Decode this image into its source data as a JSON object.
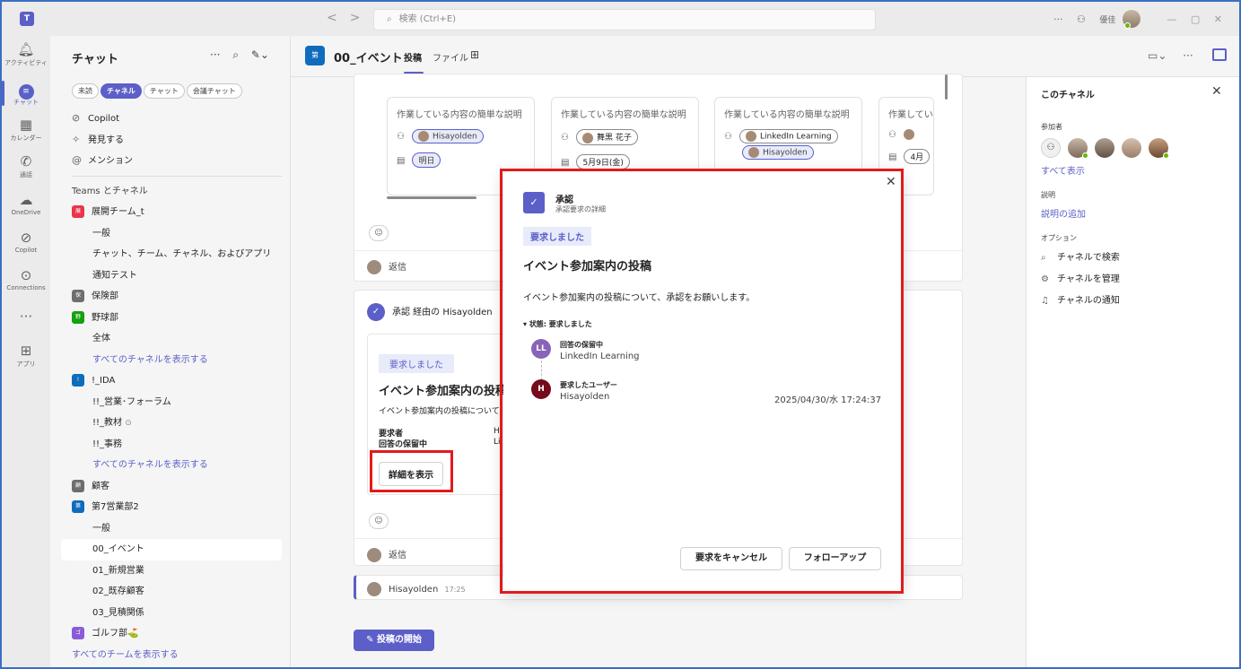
{
  "titlebar": {
    "search_placeholder": "検索 (Ctrl+E)",
    "user_name": "優佳",
    "more": "···"
  },
  "rail": [
    {
      "label": "アクティビティ",
      "icon": "bell-icon"
    },
    {
      "label": "チャット",
      "icon": "chat-icon"
    },
    {
      "label": "カレンダー",
      "icon": "calendar-icon"
    },
    {
      "label": "通話",
      "icon": "phone-icon"
    },
    {
      "label": "OneDrive",
      "icon": "cloud-icon"
    },
    {
      "label": "Copilot",
      "icon": "copilot-icon"
    },
    {
      "label": "Connections",
      "icon": "connections-icon"
    },
    {
      "label": "アプリ",
      "icon": "apps-icon"
    }
  ],
  "sidebar": {
    "title": "チャット",
    "filters": [
      "未読",
      "チャネル",
      "チャット",
      "会議チャット"
    ],
    "top_items": [
      {
        "icon": "copilot-icon",
        "label": "Copilot"
      },
      {
        "icon": "sparkle-icon",
        "label": "発見する"
      },
      {
        "icon": "at-icon",
        "label": "メンション"
      }
    ],
    "section_label": "Teams とチャネル",
    "teams": [
      {
        "name": "展開チーム_t",
        "color": "#e8364b",
        "channels": [
          "一般",
          "チャット、チーム、チャネル、およびアプリ",
          "通知テスト"
        ],
        "show_all": ""
      },
      {
        "name": "保険部",
        "color": "#6e6e6e",
        "channels": [],
        "show_all": ""
      },
      {
        "name": "野球部",
        "color": "#13a10e",
        "channels": [
          "全体"
        ],
        "show_all": "すべてのチャネルを表示する"
      },
      {
        "name": "!_IDA",
        "color": "#0f6cbd",
        "channels": [
          "!!_営業･フォーラム",
          "!!_教材",
          "!!_事務"
        ],
        "show_all": "すべてのチャネルを表示する"
      },
      {
        "name": "顧客",
        "color": "#6e6e6e",
        "channels": [],
        "show_all": ""
      },
      {
        "name": "第7営業部2",
        "color": "#0f6cbd",
        "channels": [
          "一般",
          "00_イベント",
          "01_新規営業",
          "02_既存顧客",
          "03_見積関係"
        ],
        "show_all": ""
      },
      {
        "name": "ゴルフ部⛳",
        "color": "#8a5bd6",
        "channels": [],
        "show_all": ""
      }
    ],
    "show_all_teams": "すべてのチームを表示する"
  },
  "channel": {
    "name": "00_イベント",
    "tabs": [
      "投稿",
      "ファイル"
    ],
    "add_tab": "⊞"
  },
  "feed": {
    "task_cards": [
      {
        "desc": "作業している内容の簡単な説明",
        "assignees": [
          "Hisayolden"
        ],
        "date": "明日",
        "date_style": "blue"
      },
      {
        "desc": "作業している内容の簡単な説明",
        "assignees": [
          "舞黒 花子"
        ],
        "date": "5月9日(金)",
        "date_style": "plain"
      },
      {
        "desc": "作業している内容の簡単な説明",
        "assignees": [
          "LinkedIn Learning",
          "Hisayolden"
        ],
        "date": "",
        "date_style": "plain"
      },
      {
        "desc": "作業してい",
        "assignees": [
          ""
        ],
        "date": "4月",
        "date_style": "plain"
      }
    ],
    "reply_label": "返信",
    "approval_post": {
      "header": "承認 経由の Hisayolden",
      "tag": "要求しました",
      "title": "イベント参加案内の投稿",
      "desc": "イベント参加案内の投稿について",
      "requester_label": "要求者",
      "pending_label": "回答の保留中",
      "requester_value": "H",
      "pending_value": "Li",
      "details_button": "詳細を表示"
    },
    "last_post": {
      "author": "Hisayolden",
      "time": "17:25"
    },
    "post_button": "投稿の開始"
  },
  "right_panel": {
    "title": "このチャネル",
    "participants_label": "参加者",
    "show_all": "すべて表示",
    "description_label": "説明",
    "add_description": "説明の追加",
    "options_label": "オプション",
    "options": [
      {
        "icon": "search-icon",
        "label": "チャネルで検索"
      },
      {
        "icon": "gear-icon",
        "label": "チャネルを管理"
      },
      {
        "icon": "bell-icon",
        "label": "チャネルの通知"
      }
    ]
  },
  "dialog": {
    "app_name": "承認",
    "app_sub": "承認要求の詳細",
    "tag": "要求しました",
    "title": "イベント参加案内の投稿",
    "body": "イベント参加案内の投稿について、承認をお願いします。",
    "status": "状態: 要求しました",
    "steps": [
      {
        "initials": "LL",
        "title": "回答の保留中",
        "name": "LinkedIn Learning",
        "time": "",
        "color": "#8764b8"
      },
      {
        "initials": "H",
        "title": "要求したユーザー",
        "name": "Hisayolden",
        "time": "2025/04/30/水 17:24:37",
        "color": "#750b1c"
      }
    ],
    "cancel_button": "要求をキャンセル",
    "followup_button": "フォローアップ"
  }
}
